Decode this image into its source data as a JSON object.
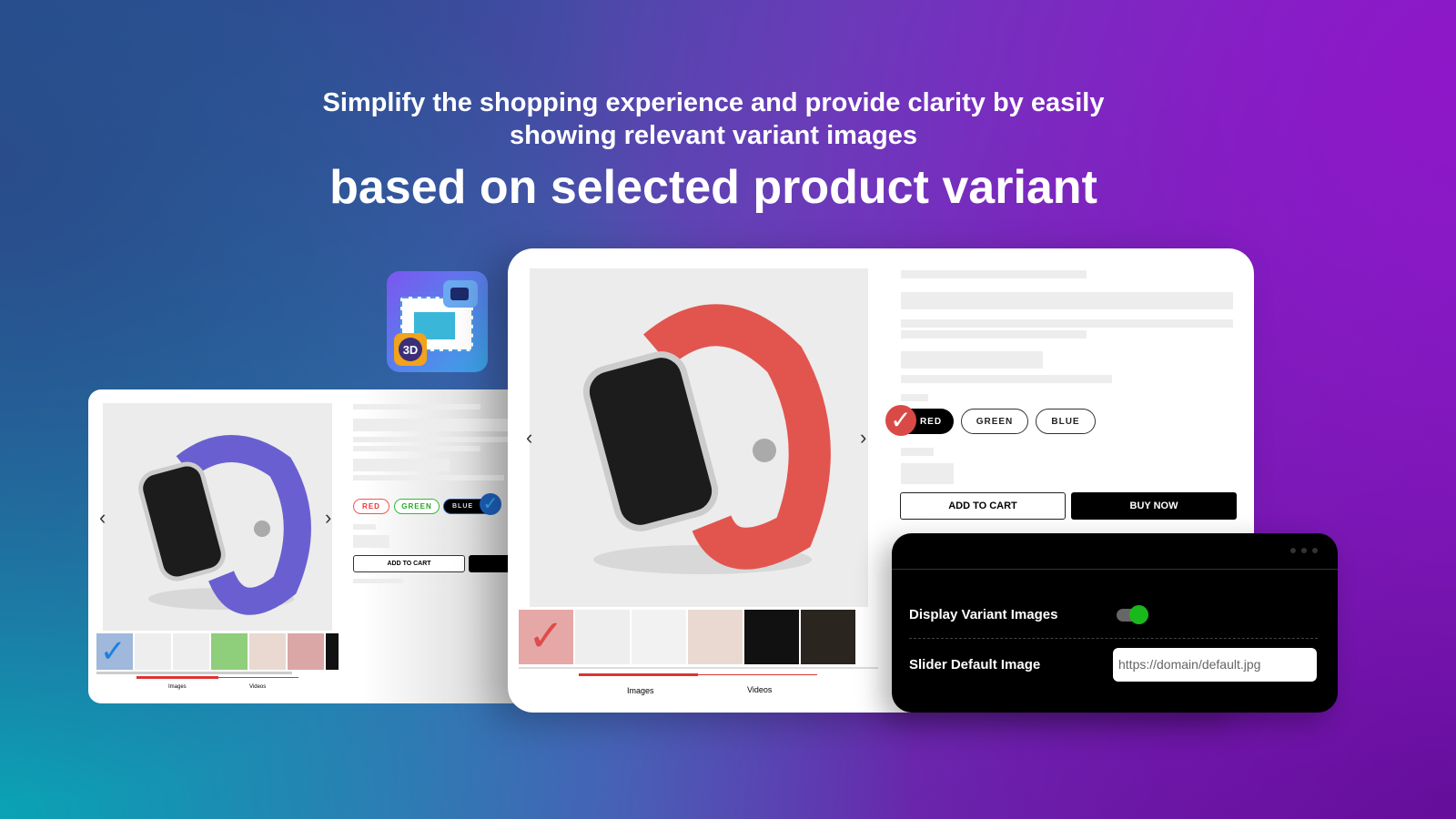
{
  "headline": {
    "line1": "Simplify the shopping experience and provide clarity by easily",
    "line2": "showing relevant variant images",
    "line3": "based on selected product variant"
  },
  "left_card": {
    "variants": [
      "RED",
      "GREEN",
      "BLUE"
    ],
    "selected": "BLUE",
    "add_to_cart": "ADD TO CART",
    "tabs": [
      "Images",
      "Videos"
    ],
    "watch_color": "#6a5fd0"
  },
  "right_card": {
    "variants": [
      "RED",
      "GREEN",
      "BLUE"
    ],
    "selected": "RED",
    "add_to_cart": "ADD TO CART",
    "buy_now": "BUY NOW",
    "tabs": [
      "Images",
      "Videos"
    ],
    "watch_color": "#e2554f"
  },
  "settings_panel": {
    "display_variant_images_label": "Display Variant Images",
    "display_variant_images_on": true,
    "slider_default_image_label": "Slider Default Image",
    "slider_default_image_value": "https://domain/default.jpg",
    "toggle_color": "#19b81c"
  },
  "app_icon": {
    "badge": "3D"
  }
}
